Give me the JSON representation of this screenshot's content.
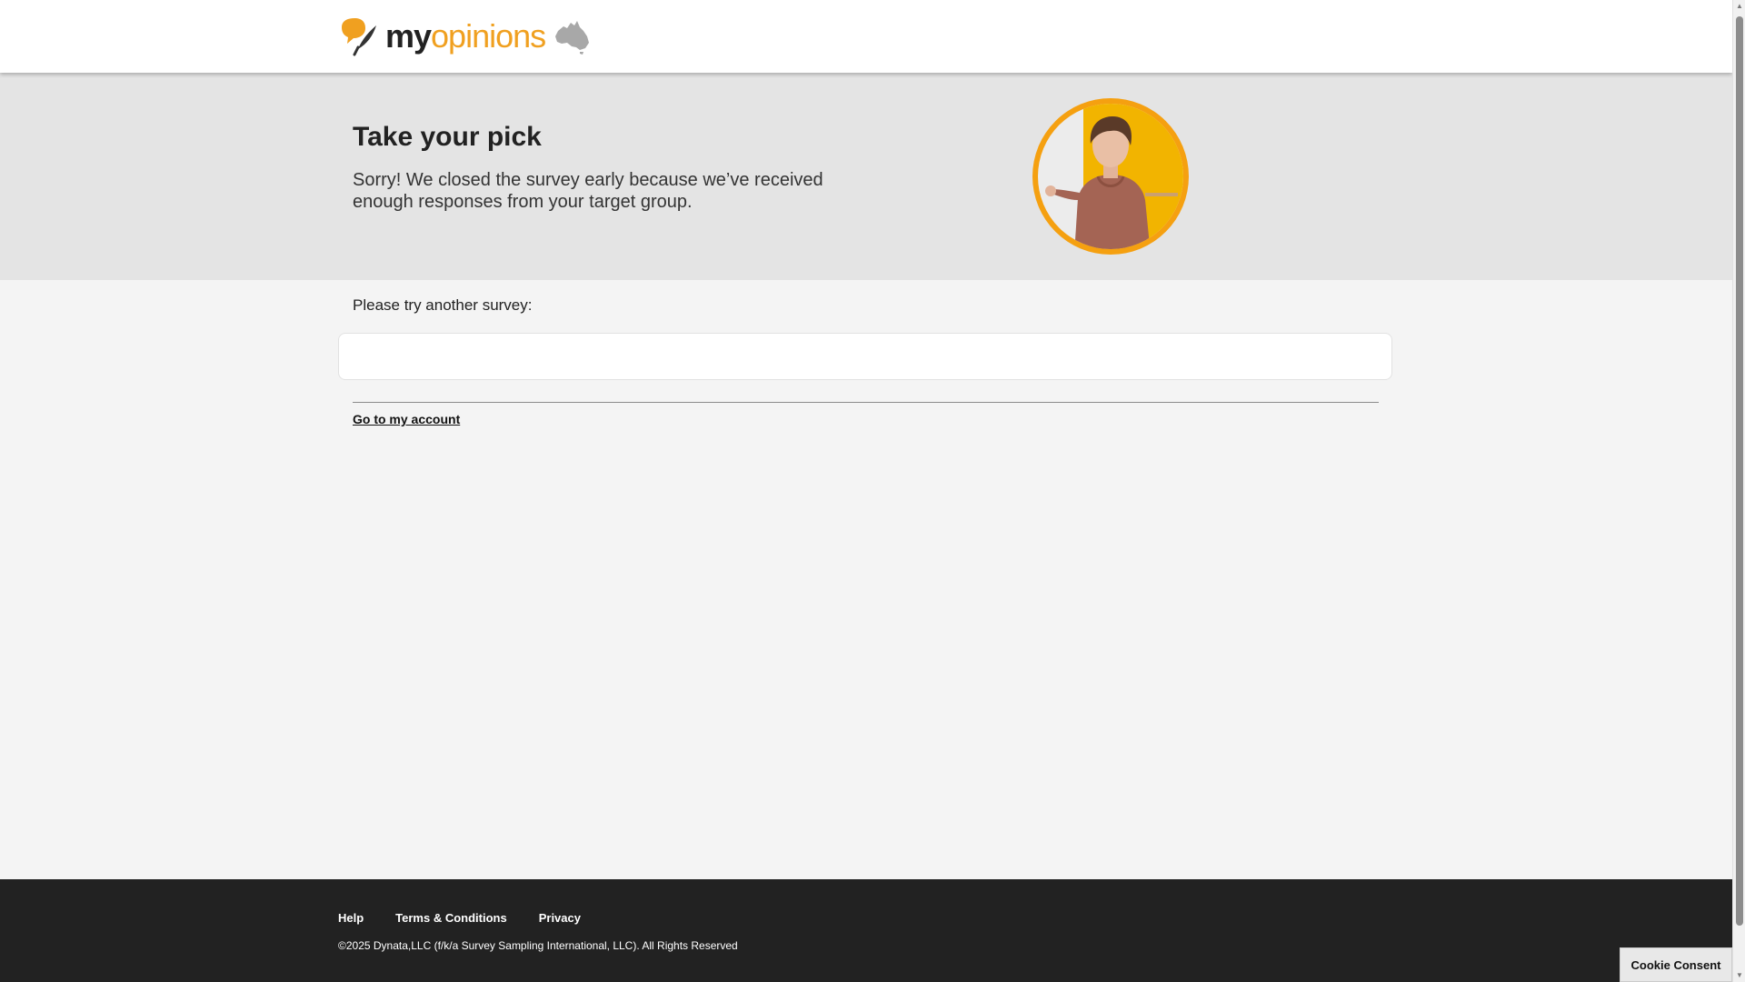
{
  "header": {
    "logo_my": "my",
    "logo_opinions": "opinions"
  },
  "hero": {
    "title": "Take your pick",
    "message": "Sorry! We closed the survey early because we’ve received enough responses from your target group."
  },
  "main": {
    "prompt": "Please try another survey:",
    "account_link": "Go to my account"
  },
  "footer": {
    "links": [
      "Help",
      "Terms & Conditions",
      "Privacy"
    ],
    "copyright": "©2025 Dynata,LLC (f/k/a Survey Sampling International, LLC). All Rights Reserved"
  },
  "cookie_consent_label": "Cookie Consent",
  "colors": {
    "brand_orange": "#f0a020",
    "footer_bg": "#222222",
    "hero_bg": "#e4e4e4"
  },
  "icons": {
    "logo_mark": "speech-leaf-logo-icon",
    "region": "australia-map-icon",
    "scroll_up": "scroll-up-arrow-icon",
    "scroll_down": "scroll-down-arrow-icon"
  }
}
